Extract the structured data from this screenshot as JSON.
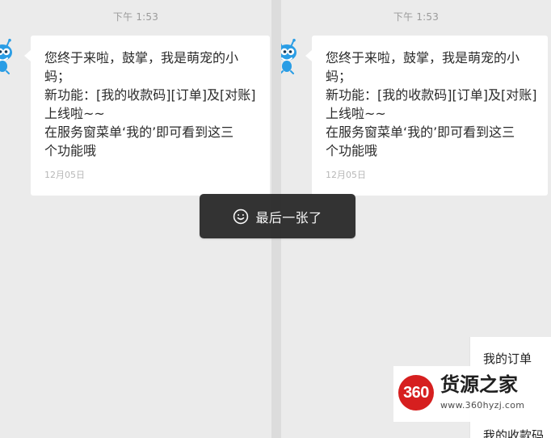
{
  "left_panel": {
    "timestamp": "下午 1:53",
    "message_lines": [
      "您终于来啦，鼓掌，我是萌宠的小",
      "蚂；",
      "新功能：[我的收款码][订单]及[对账]",
      "上线啦~~",
      "在服务窗菜单‘我的’即可看到这三",
      "个功能哦"
    ],
    "date": "12月05日"
  },
  "right_panel": {
    "timestamp": "下午 1:53",
    "message_lines": [
      "您终于来啦，鼓掌，我是萌宠的小",
      "蚂；",
      "新功能：[我的收款码][订单]及[对账]",
      "上线啦~~",
      "在服务窗菜单‘我的’即可看到这三",
      "个功能哦"
    ],
    "date": "12月05日"
  },
  "toast": {
    "icon": "smile-icon",
    "text": "最后一张了"
  },
  "menu": {
    "items": [
      "我的订单",
      "我的收款码"
    ]
  },
  "watermark": {
    "logo_text": "360",
    "title": "货源之家",
    "url": "www.360hyzj.com"
  },
  "colors": {
    "background": "#ebebeb",
    "bubble": "#ffffff",
    "toast": "#232323",
    "logo_red": "#d61f1f",
    "avatar_blue": "#2a9de5"
  }
}
